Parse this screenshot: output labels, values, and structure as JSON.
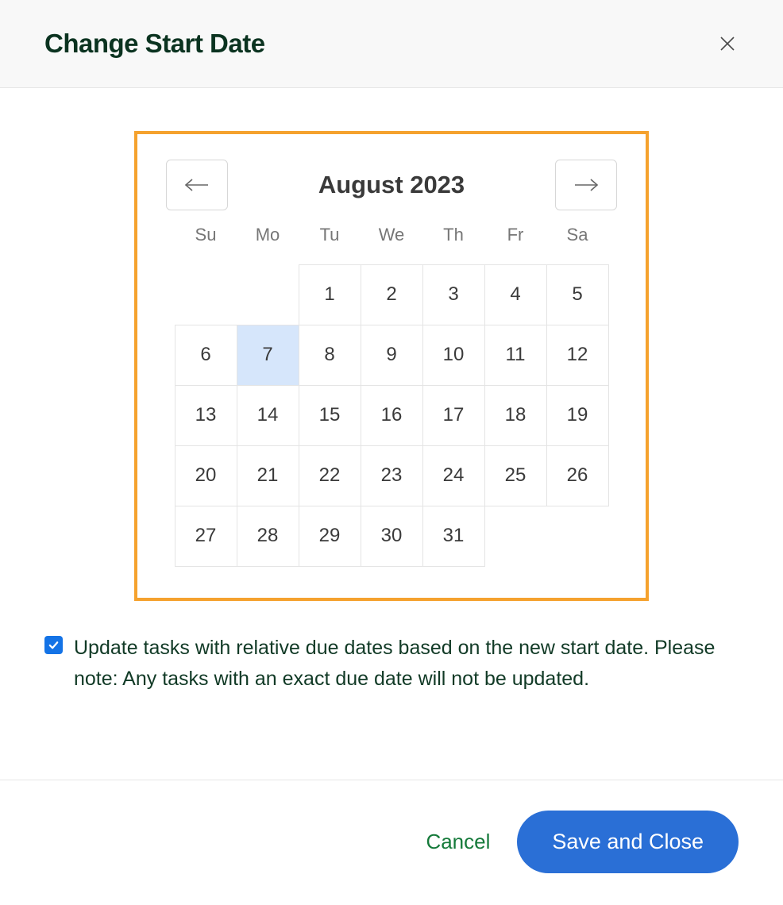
{
  "header": {
    "title": "Change Start Date"
  },
  "calendar": {
    "month_label": "August 2023",
    "dow": [
      "Su",
      "Mo",
      "Tu",
      "We",
      "Th",
      "Fr",
      "Sa"
    ],
    "leading_blanks": 2,
    "days": [
      "1",
      "2",
      "3",
      "4",
      "5",
      "6",
      "7",
      "8",
      "9",
      "10",
      "11",
      "12",
      "13",
      "14",
      "15",
      "16",
      "17",
      "18",
      "19",
      "20",
      "21",
      "22",
      "23",
      "24",
      "25",
      "26",
      "27",
      "28",
      "29",
      "30",
      "31"
    ],
    "selected_day": "7"
  },
  "checkbox": {
    "checked": true,
    "label": "Update tasks with relative due dates based on the new start date. Please note: Any tasks with an exact due date will not be updated."
  },
  "footer": {
    "cancel_label": "Cancel",
    "save_label": "Save and Close"
  }
}
